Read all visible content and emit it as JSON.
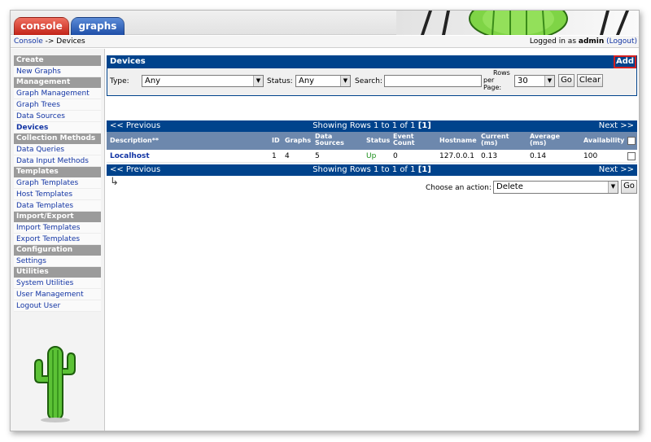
{
  "tabs": [
    {
      "label": "console",
      "active": true
    },
    {
      "label": "graphs",
      "active": false
    }
  ],
  "breadcrumb": {
    "root": "Console",
    "separator": "->",
    "current": "Devices"
  },
  "login": {
    "prefix": "Logged in as",
    "user": "admin",
    "logout": "(Logout)"
  },
  "sidebar": {
    "sections": [
      {
        "header": "Create",
        "items": [
          "New Graphs"
        ]
      },
      {
        "header": "Management",
        "items": [
          "Graph Management",
          "Graph Trees",
          "Data Sources",
          "Devices"
        ]
      },
      {
        "header": "Collection Methods",
        "items": [
          "Data Queries",
          "Data Input Methods"
        ]
      },
      {
        "header": "Templates",
        "items": [
          "Graph Templates",
          "Host Templates",
          "Data Templates"
        ]
      },
      {
        "header": "Import/Export",
        "items": [
          "Import Templates",
          "Export Templates"
        ]
      },
      {
        "header": "Configuration",
        "items": [
          "Settings"
        ]
      },
      {
        "header": "Utilities",
        "items": [
          "System Utilities",
          "User Management",
          "Logout User"
        ]
      }
    ],
    "active_item": "Devices"
  },
  "panel": {
    "title": "Devices",
    "add_label": "Add"
  },
  "filter": {
    "type_label": "Type:",
    "type_value": "Any",
    "status_label": "Status:",
    "status_value": "Any",
    "search_label": "Search:",
    "search_value": "",
    "rows_label_1": "Rows",
    "rows_label_2": "per",
    "rows_label_3": "Page:",
    "rows_value": "30",
    "go_label": "Go",
    "clear_label": "Clear"
  },
  "pager": {
    "prev": "<< Previous",
    "next": "Next >>",
    "showing": "Showing Rows 1 to 1 of 1",
    "page": "[1]"
  },
  "table": {
    "columns": {
      "description": "Description**",
      "id": "ID",
      "graphs": "Graphs",
      "ds1": "Data",
      "ds2": "Sources",
      "status": "Status",
      "ev1": "Event",
      "ev2": "Count",
      "hostname": "Hostname",
      "cur1": "Current",
      "cur2": "(ms)",
      "avg1": "Average",
      "avg2": "(ms)",
      "availability": "Availability"
    },
    "rows": [
      {
        "description": "Localhost",
        "id": "1",
        "graphs": "4",
        "data_sources": "5",
        "status": "Up",
        "event_count": "0",
        "hostname": "127.0.0.1",
        "current": "0.13",
        "average": "0.14",
        "availability": "100"
      }
    ]
  },
  "action": {
    "label": "Choose an action:",
    "value": "Delete",
    "go_label": "Go",
    "arrow_glyph": "↳"
  },
  "colors": {
    "header_blue": "#00438c",
    "column_blue": "#6d88ad",
    "status_up": "#198e19",
    "add_border": "#d32020"
  }
}
